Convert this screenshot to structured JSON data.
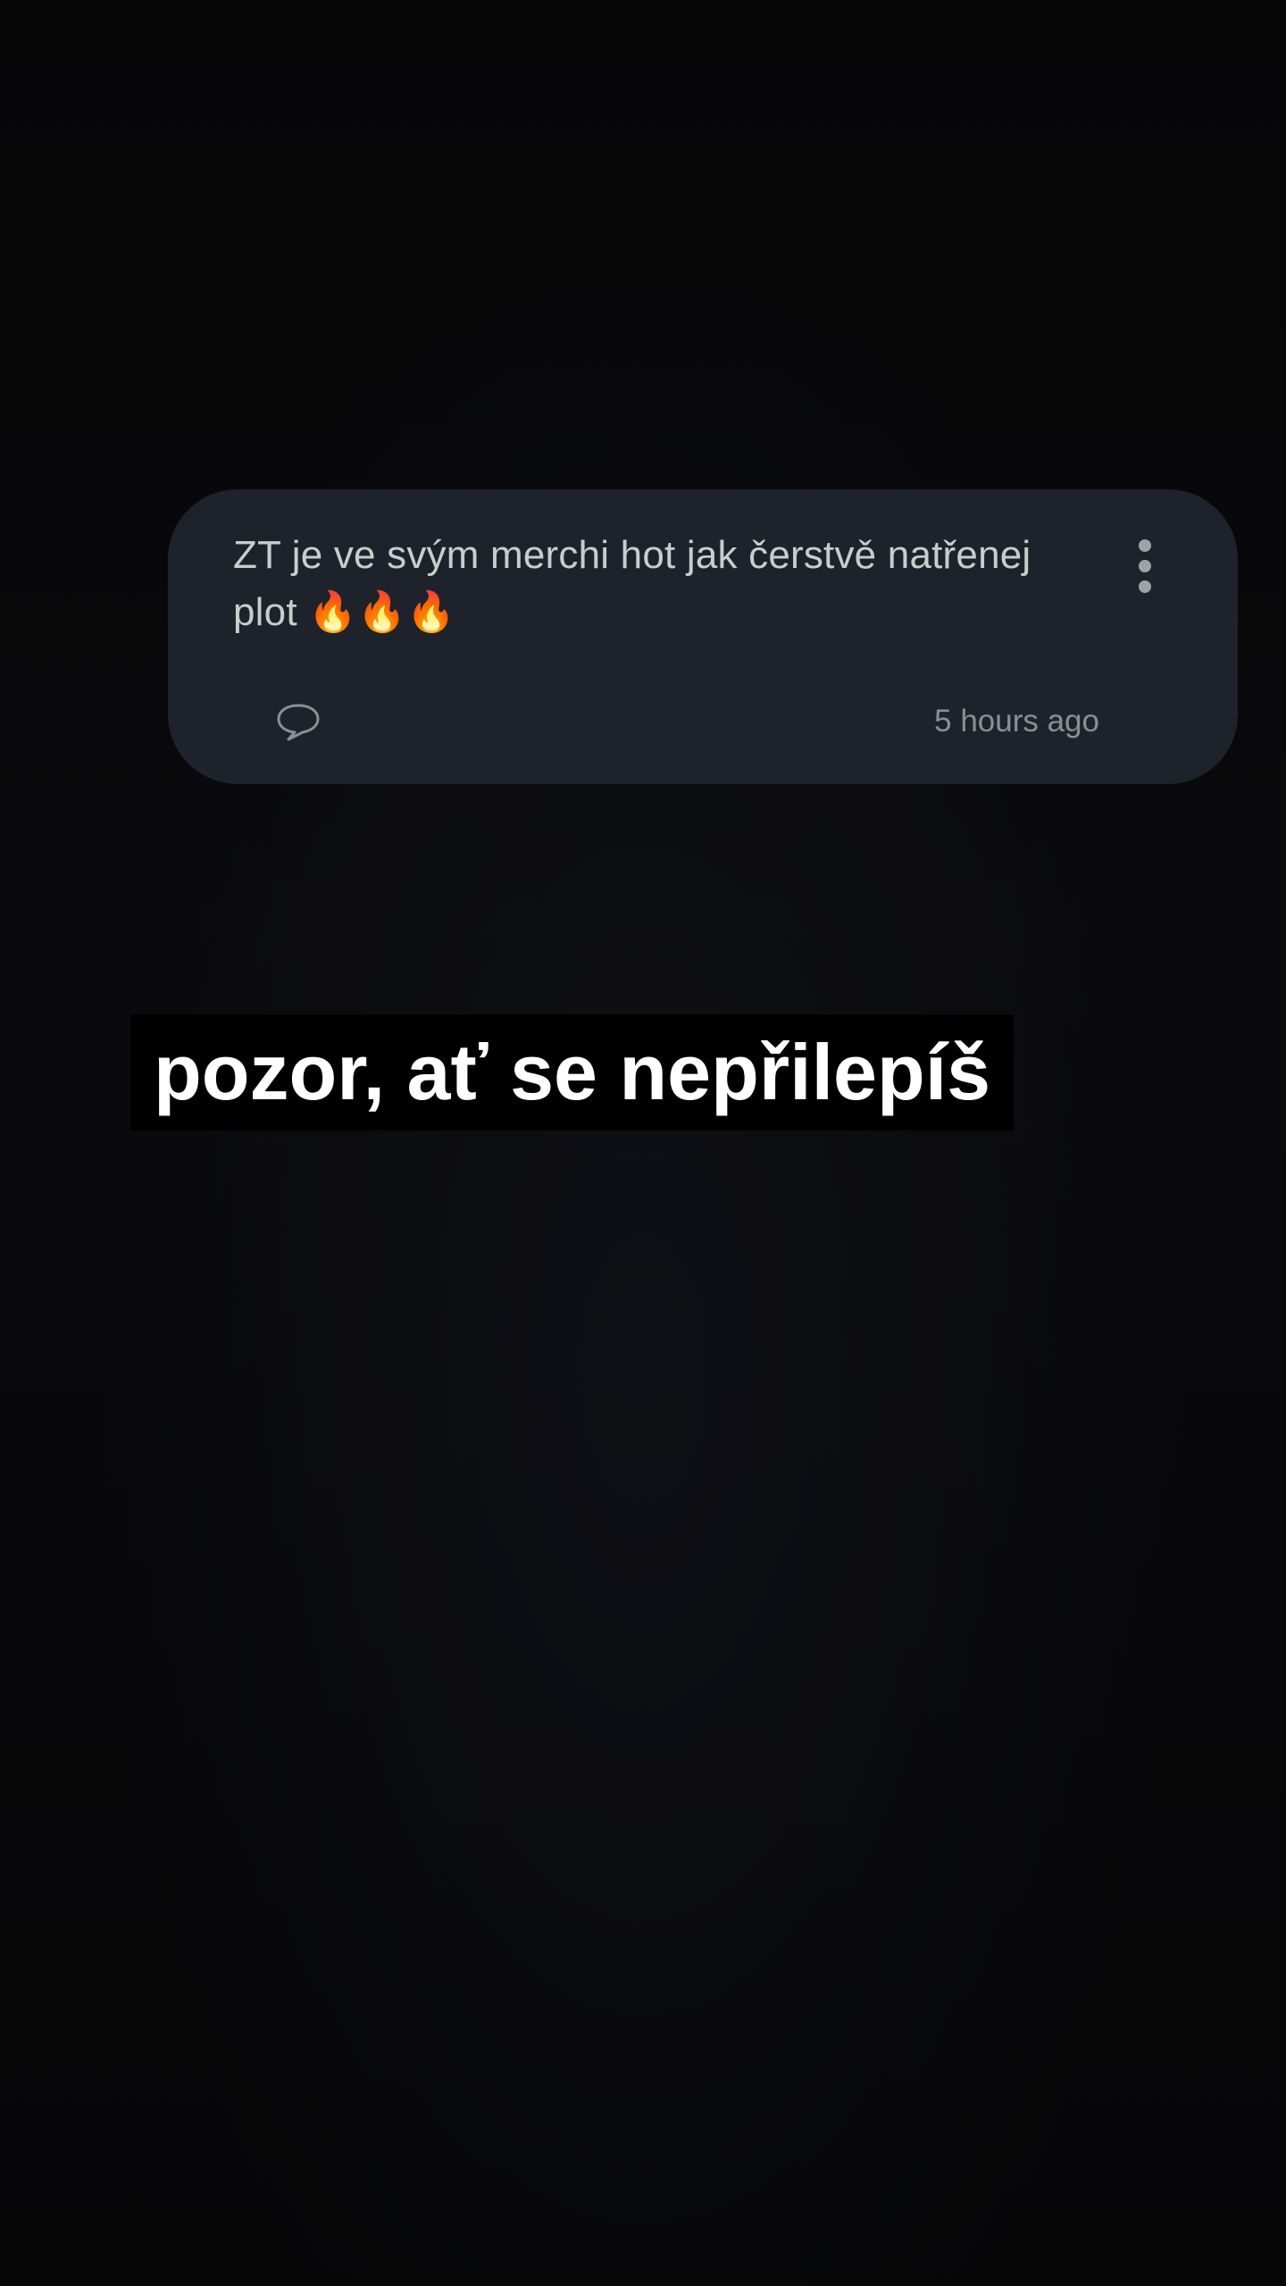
{
  "comment": {
    "text": "ZT je ve svým merchi hot jak čerstvě natřenej plot 🔥🔥🔥",
    "timestamp": "5 hours ago",
    "more_icon": "more-vertical-icon",
    "reply_icon": "comment-bubble-icon"
  },
  "caption": {
    "text": "pozor, ať se nepřilepíš"
  },
  "colors": {
    "background": "#070708",
    "card": "#1e232b",
    "comment_text": "#c9ccd1",
    "timestamp": "#8a8f96",
    "caption_bg": "#000000",
    "caption_text": "#ffffff"
  }
}
